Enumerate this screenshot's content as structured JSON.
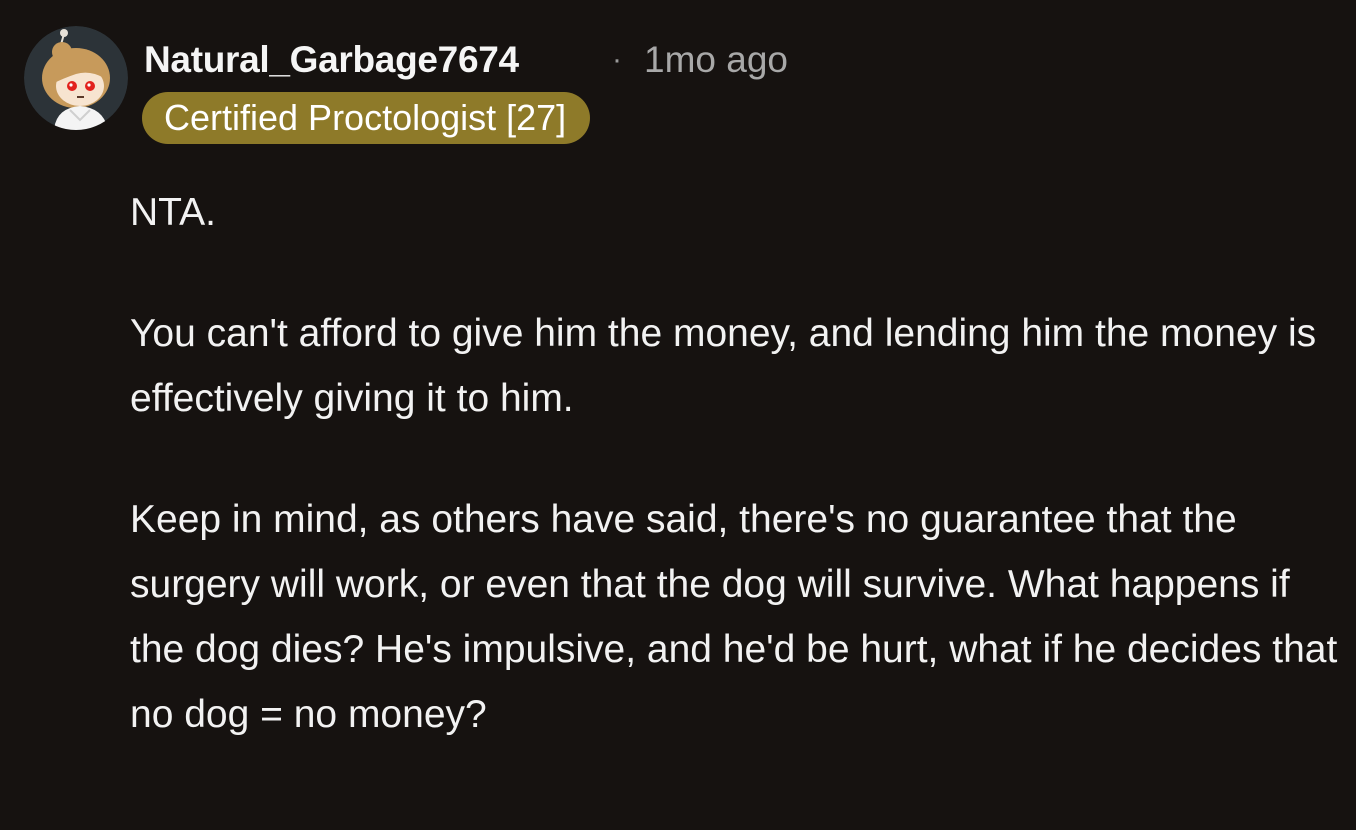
{
  "comment": {
    "author": "Natural_Garbage7674",
    "separator": "·",
    "time_ago": "1mo ago",
    "flair": "Certified Proctologist [27]",
    "avatar_icon": "snoo-avatar-icon",
    "paragraphs": [
      "NTA.",
      "You can't afford to give him the money, and lending him the money is effectively giving it to him.",
      "Keep in mind, as others have said, there's no guarantee that the surgery will work, or even that the dog will survive. What happens if the dog dies? He's impulsive, and he'd be hurt, what if he decides that no dog = no money?"
    ]
  },
  "colors": {
    "background": "#161210",
    "flair_background": "#8e7a29",
    "text": "#f2f2f2",
    "meta_text": "#a8a8a8"
  }
}
